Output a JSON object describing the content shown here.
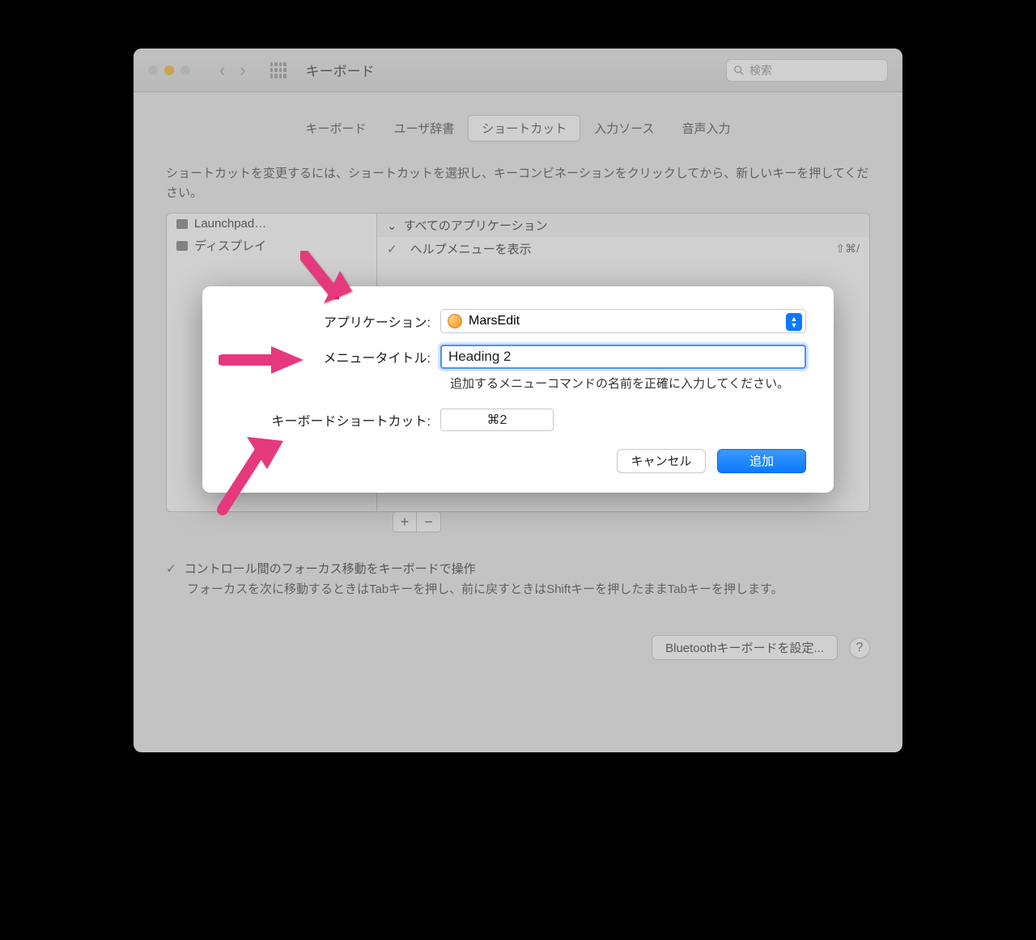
{
  "window": {
    "title": "キーボード",
    "search_placeholder": "検索"
  },
  "tabs": [
    "キーボード",
    "ユーザ辞書",
    "ショートカット",
    "入力ソース",
    "音声入力"
  ],
  "active_tab": "ショートカット",
  "instructions": "ショートカットを変更するには、ショートカットを選択し、キーコンビネーションをクリックしてから、新しいキーを押してください。",
  "sidebar": [
    {
      "label": "Launchpad…"
    },
    {
      "label": "ディスプレイ"
    }
  ],
  "disclosure_header": "すべてのアプリケーション",
  "shortcut_rows": [
    {
      "label": "ヘルプメニューを表示",
      "shortcut": "⇧⌘/"
    }
  ],
  "checkbox_label": "コントロール間のフォーカス移動をキーボードで操作",
  "checkbox_sub": "フォーカスを次に移動するときはTabキーを押し、前に戻すときはShiftキーを押したままTabキーを押します。",
  "bluetooth_btn": "Bluetoothキーボードを設定...",
  "modal": {
    "app_label": "アプリケーション:",
    "app_value": "MarsEdit",
    "menu_label": "メニュータイトル:",
    "menu_value": "Heading 2",
    "menu_hint": "追加するメニューコマンドの名前を正確に入力してください。",
    "shortcut_label": "キーボードショートカット:",
    "shortcut_value": "⌘2",
    "cancel": "キャンセル",
    "add": "追加"
  }
}
